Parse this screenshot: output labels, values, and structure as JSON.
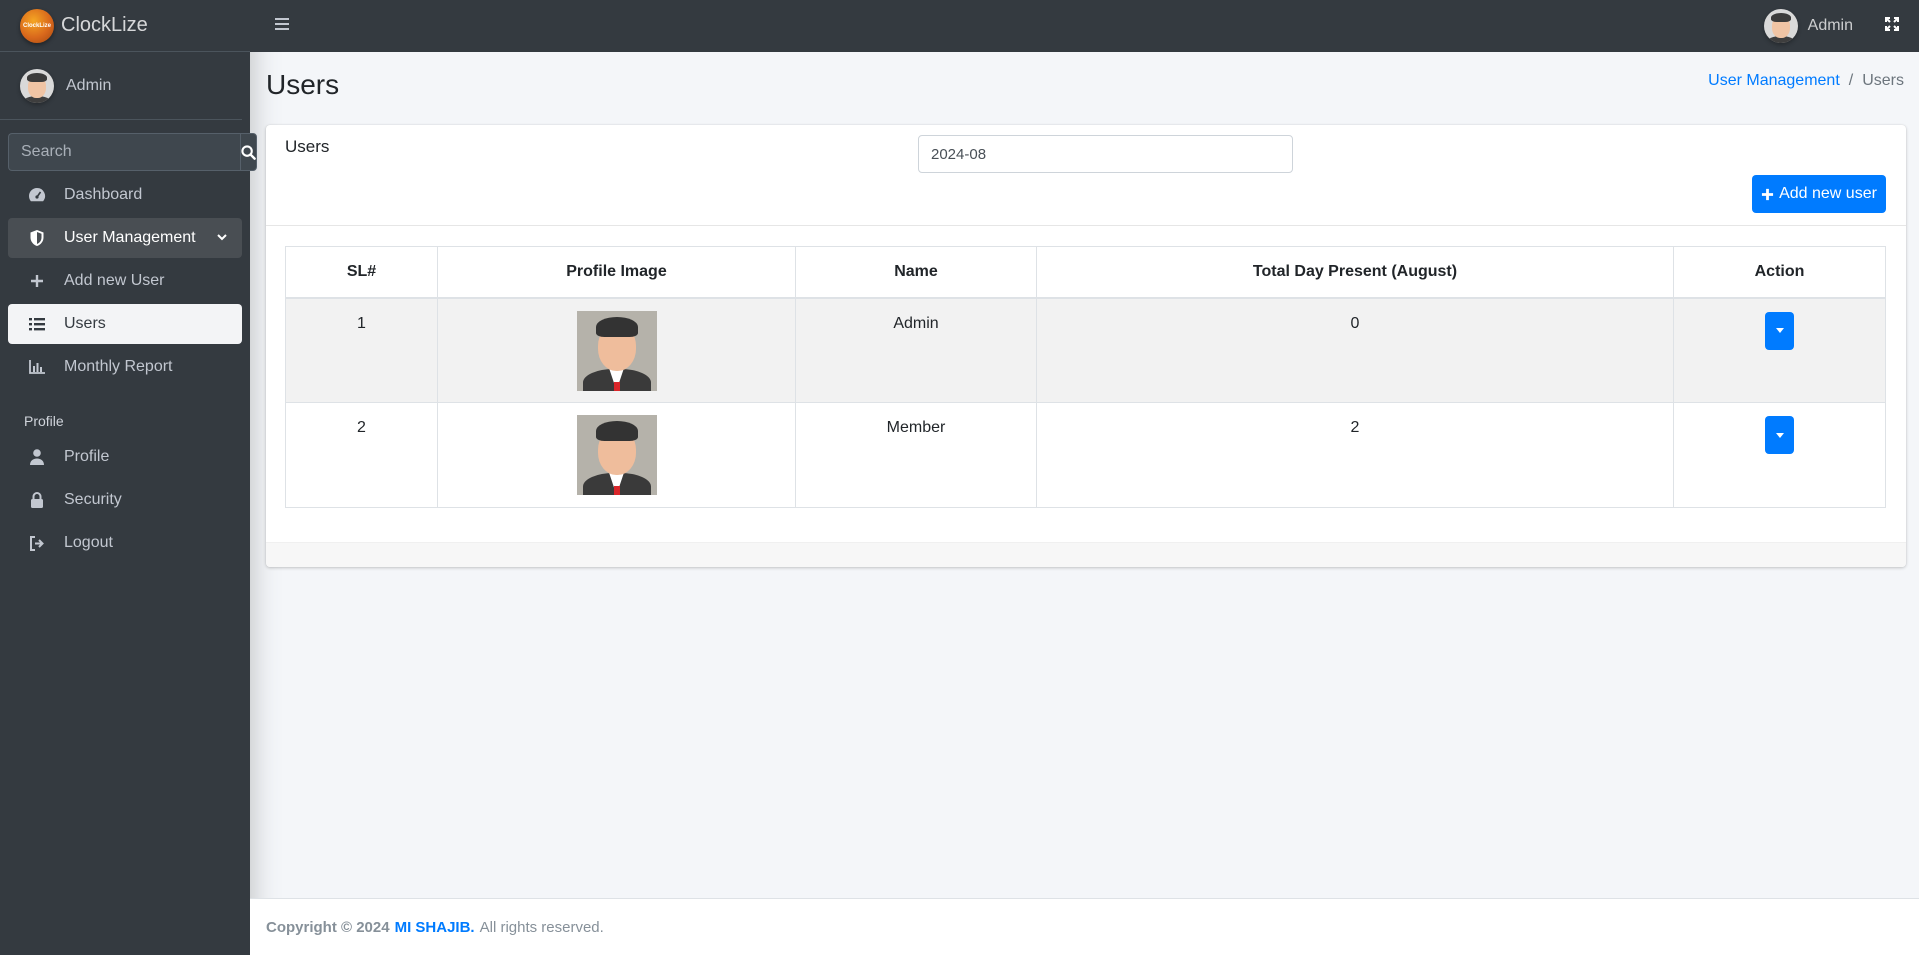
{
  "brand": {
    "name": "ClockLize",
    "logo_text": "ClockLize"
  },
  "user_panel": {
    "name": "Admin"
  },
  "search": {
    "placeholder": "Search"
  },
  "sidebar": {
    "items": [
      {
        "label": "Dashboard",
        "icon": "dashboard-icon"
      },
      {
        "label": "User Management",
        "icon": "shield-icon",
        "open": true
      },
      {
        "label": "Add new User",
        "icon": "plus-icon"
      },
      {
        "label": "Users",
        "icon": "list-icon",
        "active": true
      },
      {
        "label": "Monthly Report",
        "icon": "chart-icon"
      }
    ],
    "section_header": "Profile",
    "profile_items": [
      {
        "label": "Profile",
        "icon": "user-icon"
      },
      {
        "label": "Security",
        "icon": "lock-icon"
      },
      {
        "label": "Logout",
        "icon": "logout-icon"
      }
    ]
  },
  "topbar": {
    "user_name": "Admin"
  },
  "page": {
    "title": "Users",
    "breadcrumb": {
      "parent": "User Management",
      "current": "Users"
    }
  },
  "card": {
    "title": "Users",
    "month_value": "2024-08",
    "add_button_label": "Add new user"
  },
  "table": {
    "columns": [
      "SL#",
      "Profile Image",
      "Name",
      "Total Day Present (August)",
      "Action"
    ],
    "rows": [
      {
        "sl": "1",
        "name": "Admin",
        "present": "0"
      },
      {
        "sl": "2",
        "name": "Member",
        "present": "2"
      }
    ]
  },
  "footer": {
    "copyright": "Copyright © 2024",
    "author": "MI SHAJIB.",
    "rights": "All rights reserved."
  },
  "colors": {
    "sidebar_bg": "#343a40",
    "primary": "#007bff",
    "content_bg": "#f4f6f9"
  }
}
